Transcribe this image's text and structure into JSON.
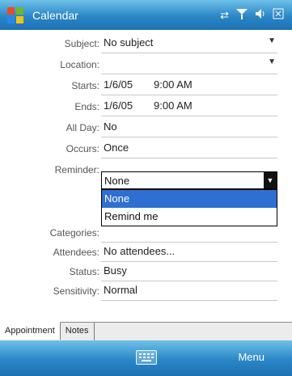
{
  "titlebar": {
    "app_title": "Calendar",
    "icons": [
      "windows-start-icon",
      "sync-icon",
      "signal-icon",
      "volume-icon",
      "close-icon"
    ]
  },
  "form": {
    "subject": {
      "label": "Subject:",
      "value": "No subject"
    },
    "location": {
      "label": "Location:",
      "value": ""
    },
    "starts": {
      "label": "Starts:",
      "date": "1/6/05",
      "time": "9:00 AM"
    },
    "ends": {
      "label": "Ends:",
      "date": "1/6/05",
      "time": "9:00 AM"
    },
    "all_day": {
      "label": "All Day:",
      "value": "No"
    },
    "occurs": {
      "label": "Occurs:",
      "value": "Once"
    },
    "reminder": {
      "label": "Reminder:",
      "selected": "None",
      "options": [
        "None",
        "Remind me"
      ],
      "highlighted": "None"
    },
    "categories": {
      "label": "Categories:",
      "value": ""
    },
    "attendees": {
      "label": "Attendees:",
      "value": "No attendees..."
    },
    "status": {
      "label": "Status:",
      "value": "Busy"
    },
    "sensitivity": {
      "label": "Sensitivity:",
      "value": "Normal"
    }
  },
  "tabs": [
    "Appointment",
    "Notes"
  ],
  "menubar": {
    "right_label": "Menu"
  },
  "colors": {
    "bar_blue": "#2a86c6",
    "highlight": "#2f6fd1"
  }
}
